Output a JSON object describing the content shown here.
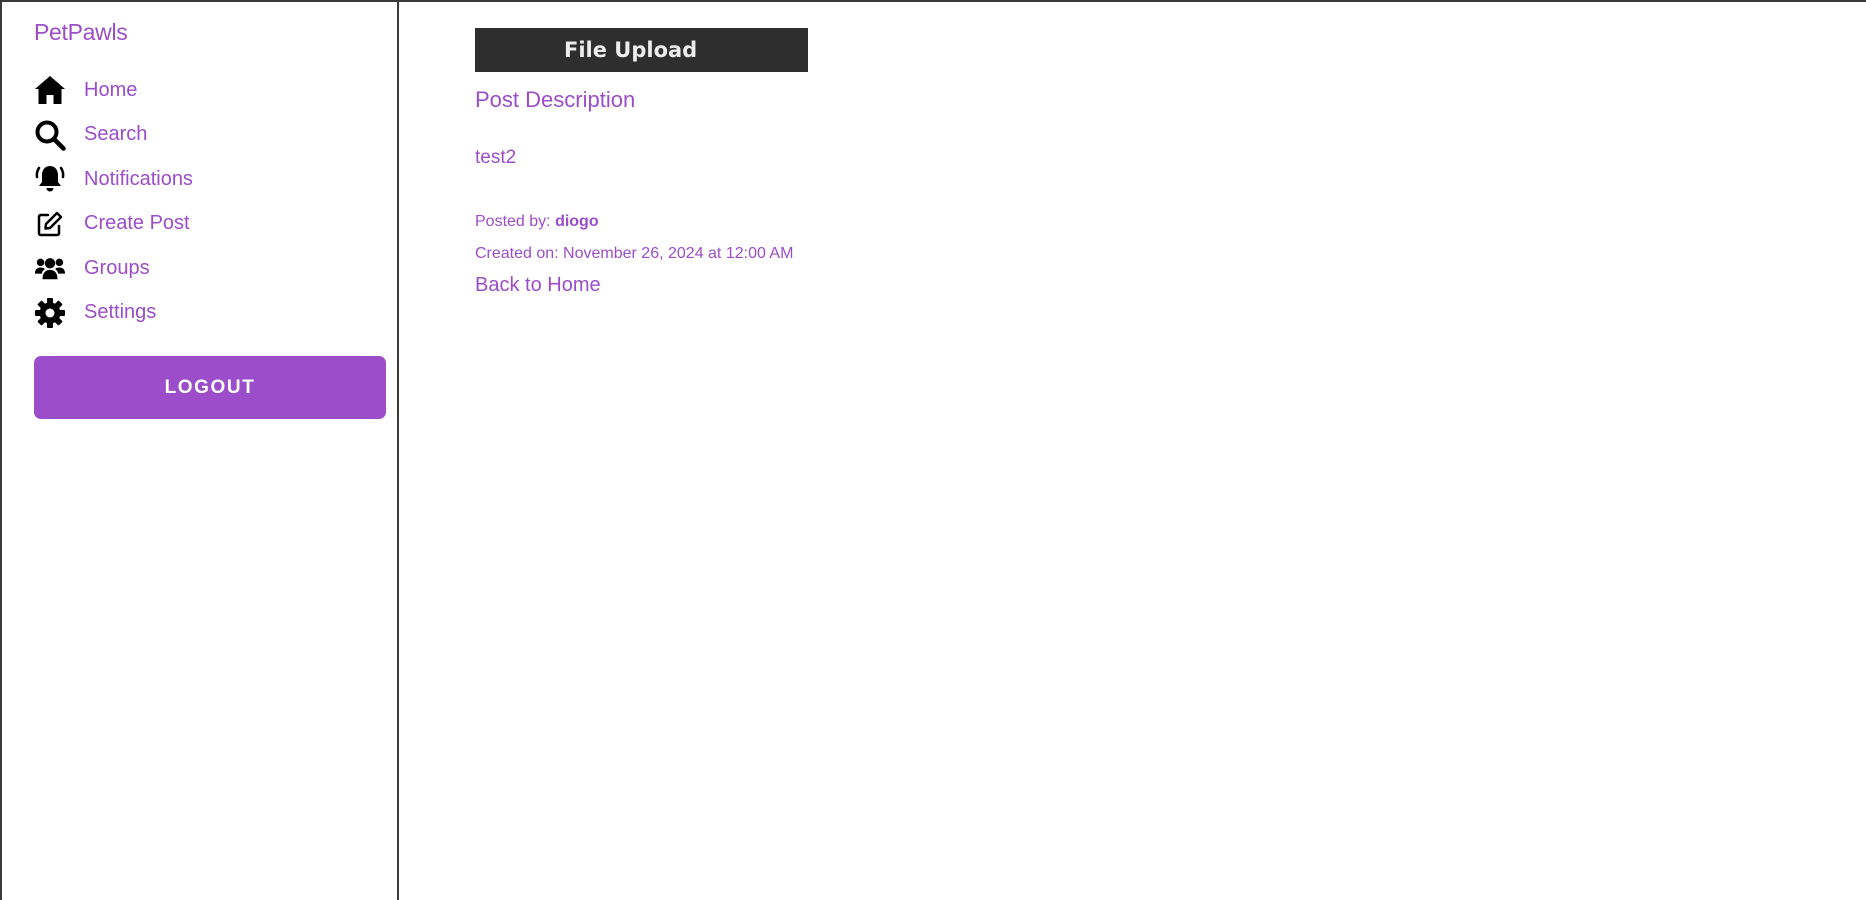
{
  "sidebar": {
    "brand": "PetPawls",
    "items": [
      {
        "label": "Home",
        "icon": "home-icon"
      },
      {
        "label": "Search",
        "icon": "search-icon"
      },
      {
        "label": "Notifications",
        "icon": "bell-icon"
      },
      {
        "label": "Create Post",
        "icon": "edit-icon"
      },
      {
        "label": "Groups",
        "icon": "users-icon"
      },
      {
        "label": "Settings",
        "icon": "gear-icon"
      }
    ],
    "logout_label": "LOGOUT"
  },
  "post": {
    "file_upload_label": "File Upload",
    "title": "Post Description",
    "body": "test2",
    "posted_by_label": "Posted by:",
    "author": "diogo",
    "created_label": "Created on: November 26, 2024 at 12:00 AM",
    "back_link": "Back to Home"
  },
  "colors": {
    "accent": "#9b4dca",
    "upload_bg": "#2e2e2e",
    "border": "#3a3a3a"
  }
}
